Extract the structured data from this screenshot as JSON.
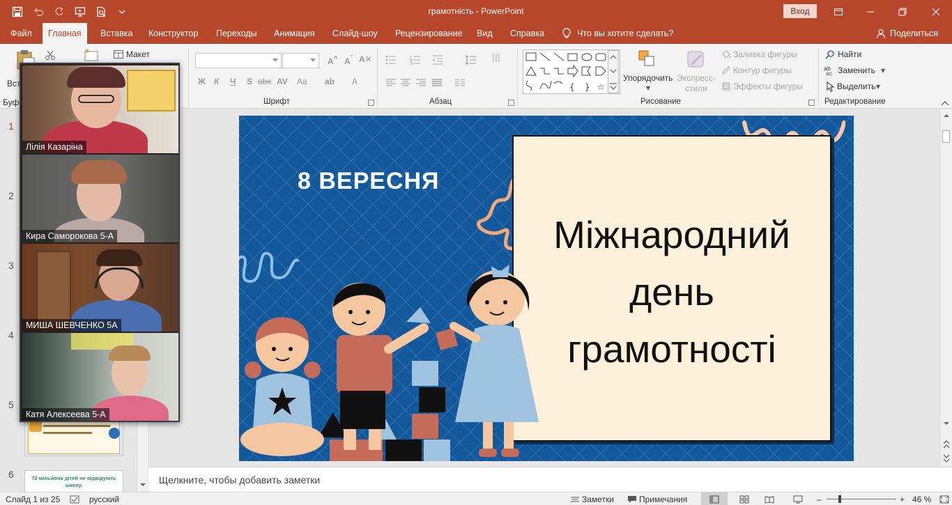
{
  "app": {
    "title": "грамотність  -  PowerPoint",
    "signin_label": "Вход"
  },
  "tabs": [
    {
      "label": "Файл"
    },
    {
      "label": "Главная"
    },
    {
      "label": "Вставка"
    },
    {
      "label": "Конструктор"
    },
    {
      "label": "Переходы"
    },
    {
      "label": "Анимация"
    },
    {
      "label": "Слайд-шоу"
    },
    {
      "label": "Рецензирование"
    },
    {
      "label": "Вид"
    },
    {
      "label": "Справка"
    }
  ],
  "active_tab": "Главная",
  "tell_me": "Что вы хотите сделать?",
  "share_label": "Поделиться",
  "ribbon": {
    "clipboard": {
      "paste_label": "Вст",
      "group_label": "Буф"
    },
    "slides": {
      "layout_label": "Макет"
    },
    "font": {
      "group_label": "Шрифт",
      "bold": "Ж",
      "italic": "К",
      "underline": "Ч",
      "shadow": "S",
      "strike": "abc",
      "case": "Aa",
      "color": "A"
    },
    "paragraph": {
      "group_label": "Абзац"
    },
    "drawing": {
      "group_label": "Рисование",
      "arrange_label": "Упорядочить",
      "quick_styles_label": "Экспресс-стили",
      "fill_label": "Заливка фигуры",
      "outline_label": "Контур фигуры",
      "effects_label": "Эффекты фигуры"
    },
    "editing": {
      "group_label": "Редактирование",
      "find_label": "Найти",
      "replace_label": "Заменить",
      "select_label": "Выделить"
    }
  },
  "slides_panel": {
    "numbers": [
      "1",
      "2",
      "3",
      "4",
      "5",
      "6"
    ],
    "thumb6_text": "72 мільйона дітей не відвідують школу."
  },
  "slide": {
    "date": "8 ВЕРЕСНЯ",
    "title_lines": [
      "Міжнародний",
      "день",
      "грамотності"
    ]
  },
  "notes_placeholder": "Щелкните, чтобы добавить заметки",
  "status": {
    "slide_counter": "Слайд 1 из 25",
    "language": "русский",
    "notes_label": "Заметки",
    "comments_label": "Примечания",
    "zoom_level": "46 %"
  },
  "video_call": {
    "participants": [
      {
        "name": "Лілія Казаріна"
      },
      {
        "name": "Кира Саморокова 5-А"
      },
      {
        "name": "МИША ШЕВЧЕНКО 5А"
      },
      {
        "name": "Катя Алексеева 5-А"
      }
    ]
  }
}
